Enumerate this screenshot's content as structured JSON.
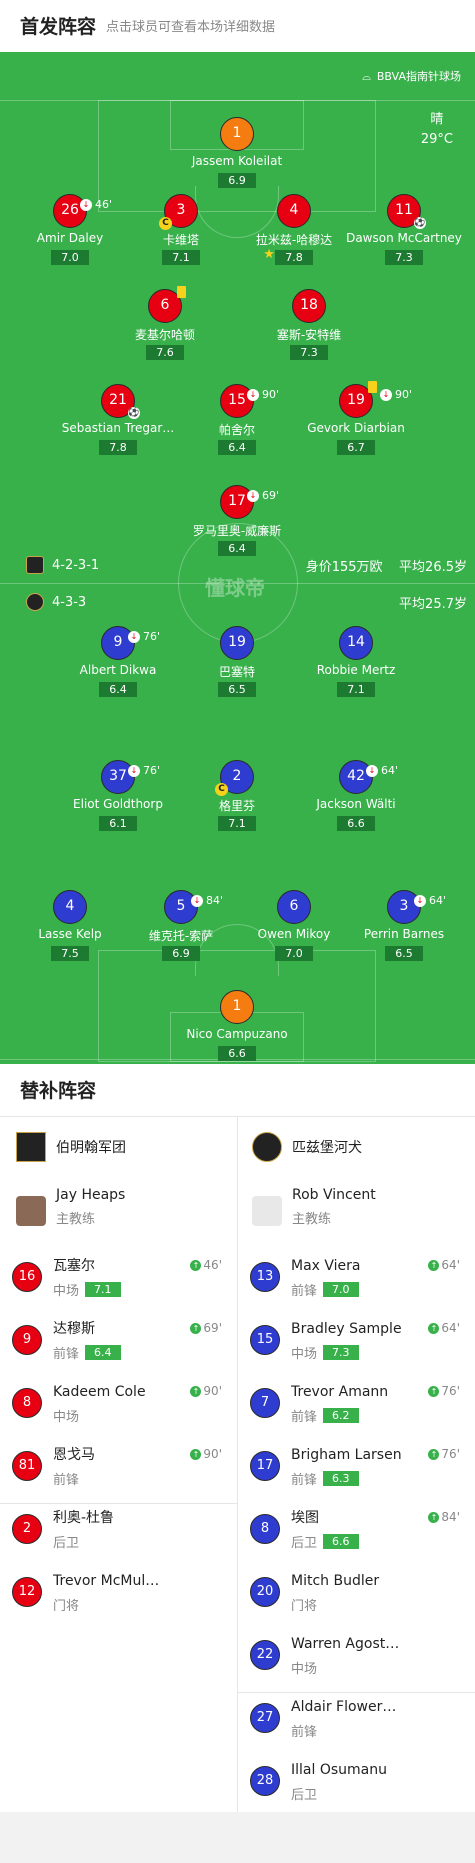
{
  "header": {
    "title": "首发阵容",
    "subtitle": "点击球员可查看本场详细数据"
  },
  "field": {
    "stadium": "BBVA指南针球场",
    "weather": "晴",
    "temperature": "29°C",
    "watermark": "懂球帝"
  },
  "home": {
    "formation": "4-2-3-1",
    "value": "身价155万欧",
    "avg_age": "平均26.5岁",
    "players": [
      {
        "num": "1",
        "name": "Jassem Koleilat",
        "rating": "6.9",
        "color": "orange"
      },
      {
        "num": "26",
        "name": "Amir Daley",
        "rating": "7.0",
        "color": "red",
        "sub": "46'"
      },
      {
        "num": "3",
        "name": "卡维塔",
        "rating": "7.1",
        "color": "red",
        "captain": "C"
      },
      {
        "num": "4",
        "name": "拉米兹-哈穆达",
        "rating": "7.8",
        "color": "red",
        "star": "★"
      },
      {
        "num": "11",
        "name": "Dawson McCartney",
        "rating": "7.3",
        "color": "red",
        "ball": "⚽"
      },
      {
        "num": "6",
        "name": "麦基尔哈顿",
        "rating": "7.6",
        "color": "red",
        "yellow": true
      },
      {
        "num": "18",
        "name": "塞斯-安特维",
        "rating": "7.3",
        "color": "red"
      },
      {
        "num": "21",
        "name": "Sebastian Tregar…",
        "rating": "7.8",
        "color": "red",
        "ball": "⚽"
      },
      {
        "num": "15",
        "name": "帕舍尔",
        "rating": "6.4",
        "color": "red",
        "sub": "90'"
      },
      {
        "num": "19",
        "name": "Gevork Diarbian",
        "rating": "6.7",
        "color": "red",
        "sub": "90'",
        "yellow": true
      },
      {
        "num": "17",
        "name": "罗马里奥-威廉斯",
        "rating": "6.4",
        "color": "red",
        "sub": "69'"
      }
    ]
  },
  "away": {
    "formation": "4-3-3",
    "avg_age": "平均25.7岁",
    "players": [
      {
        "num": "9",
        "name": "Albert Dikwa",
        "rating": "6.4",
        "color": "blue",
        "sub": "76'"
      },
      {
        "num": "19",
        "name": "巴塞特",
        "rating": "6.5",
        "color": "blue"
      },
      {
        "num": "14",
        "name": "Robbie Mertz",
        "rating": "7.1",
        "color": "blue"
      },
      {
        "num": "37",
        "name": "Eliot Goldthorp",
        "rating": "6.1",
        "color": "blue",
        "sub": "76'"
      },
      {
        "num": "2",
        "name": "格里芬",
        "rating": "7.1",
        "color": "blue",
        "captain": "C"
      },
      {
        "num": "42",
        "name": "Jackson Wälti",
        "rating": "6.6",
        "color": "blue",
        "sub": "64'"
      },
      {
        "num": "4",
        "name": "Lasse Kelp",
        "rating": "7.5",
        "color": "blue"
      },
      {
        "num": "5",
        "name": "维克托-索萨",
        "rating": "6.9",
        "color": "blue",
        "sub": "84'"
      },
      {
        "num": "6",
        "name": "Owen Mikoy",
        "rating": "7.0",
        "color": "blue"
      },
      {
        "num": "3",
        "name": "Perrin Barnes",
        "rating": "6.5",
        "color": "blue",
        "sub": "64'"
      },
      {
        "num": "1",
        "name": "Nico Campuzano",
        "rating": "6.6",
        "color": "orange"
      }
    ]
  },
  "subs": {
    "title": "替补阵容",
    "left": {
      "team": "伯明翰军团",
      "coach": {
        "name": "Jay Heaps",
        "role": "主教练"
      },
      "players": [
        {
          "num": "16",
          "name": "瓦塞尔",
          "pos": "中场",
          "rating": "7.1",
          "minute": "46'"
        },
        {
          "num": "9",
          "name": "达穆斯",
          "pos": "前锋",
          "rating": "6.4",
          "minute": "69'"
        },
        {
          "num": "8",
          "name": "Kadeem Cole",
          "pos": "中场",
          "rating": "",
          "minute": "90'"
        },
        {
          "num": "81",
          "name": "恩戈马",
          "pos": "前锋",
          "rating": "",
          "minute": "90'"
        },
        {
          "num": "2",
          "name": "利奥-杜鲁",
          "pos": "后卫",
          "rating": "",
          "minute": ""
        },
        {
          "num": "12",
          "name": "Trevor McMul…",
          "pos": "门将",
          "rating": "",
          "minute": ""
        }
      ]
    },
    "right": {
      "team": "匹兹堡河犬",
      "coach": {
        "name": "Rob Vincent",
        "role": "主教练"
      },
      "players": [
        {
          "num": "13",
          "name": "Max Viera",
          "pos": "前锋",
          "rating": "7.0",
          "minute": "64'"
        },
        {
          "num": "15",
          "name": "Bradley Sample",
          "pos": "中场",
          "rating": "7.3",
          "minute": "64'"
        },
        {
          "num": "7",
          "name": "Trevor Amann",
          "pos": "前锋",
          "rating": "6.2",
          "minute": "76'"
        },
        {
          "num": "17",
          "name": "Brigham Larsen",
          "pos": "前锋",
          "rating": "6.3",
          "minute": "76'"
        },
        {
          "num": "8",
          "name": "埃图",
          "pos": "后卫",
          "rating": "6.6",
          "minute": "84'"
        },
        {
          "num": "20",
          "name": "Mitch Budler",
          "pos": "门将",
          "rating": "",
          "minute": ""
        },
        {
          "num": "22",
          "name": "Warren Agost…",
          "pos": "中场",
          "rating": "",
          "minute": ""
        },
        {
          "num": "27",
          "name": "Aldair Flower…",
          "pos": "前锋",
          "rating": "",
          "minute": ""
        },
        {
          "num": "28",
          "name": "Illal Osumanu",
          "pos": "后卫",
          "rating": "",
          "minute": ""
        }
      ]
    }
  },
  "colors": {
    "pitch": "#38b14b",
    "home": "#e60012",
    "away": "#2f3cd0",
    "keeper": "#f47c10",
    "rating": "#1d7a31"
  }
}
